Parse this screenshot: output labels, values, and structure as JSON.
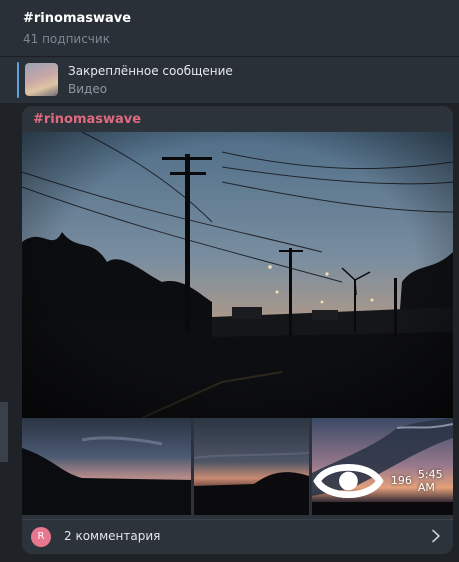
{
  "header": {
    "channel_title": "#rinomaswave",
    "subscribers": "41 подписчик"
  },
  "pinned": {
    "title": "Закреплённое сообщение",
    "subtitle": "Видео"
  },
  "post": {
    "tag": "#rinomaswave",
    "views": "196",
    "time": "5:45 AM",
    "comments": {
      "avatar_letter": "R",
      "label": "2 комментария"
    }
  },
  "colors": {
    "tag": "#e0697f",
    "avatar": "#e6778f",
    "pinned_bar": "#5ea0d7"
  }
}
